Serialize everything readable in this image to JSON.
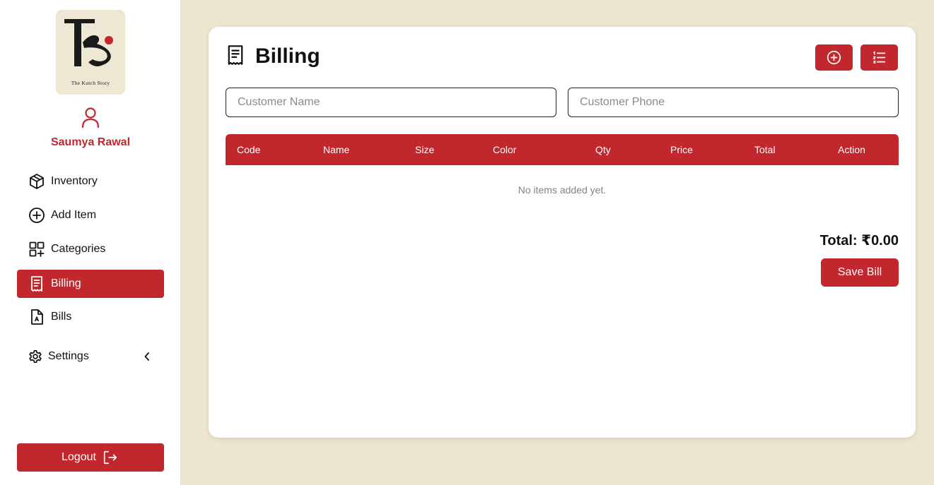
{
  "brand": {
    "logo_text": "The Kutch Story",
    "accent_color": "#c1272d",
    "background_color": "#eee7d0"
  },
  "user": {
    "icon": "user-icon",
    "name": "Saumya Rawal"
  },
  "sidebar": {
    "items": [
      {
        "label": "Inventory",
        "icon": "package-icon",
        "active": false
      },
      {
        "label": "Add Item",
        "icon": "plus-circle-icon",
        "active": false
      },
      {
        "label": "Categories",
        "icon": "grid-plus-icon",
        "active": false
      },
      {
        "label": "Billing",
        "icon": "receipt-icon",
        "active": true
      },
      {
        "label": "Bills",
        "icon": "file-icon",
        "active": false
      },
      {
        "label": "Settings",
        "icon": "gear-icon",
        "active": false,
        "expandable": true
      }
    ],
    "logout_label": "Logout"
  },
  "main": {
    "title": "Billing",
    "title_icon": "receipt-icon",
    "header_buttons": [
      {
        "icon": "plus-circle-icon"
      },
      {
        "icon": "list-icon"
      }
    ],
    "customer_name_placeholder": "Customer Name",
    "customer_phone_placeholder": "Customer Phone",
    "table": {
      "columns": [
        "Code",
        "Name",
        "Size",
        "Color",
        "Qty",
        "Price",
        "Total",
        "Action"
      ],
      "rows": [],
      "empty_message": "No items added yet."
    },
    "total_text": "Total: ₹0.00",
    "save_label": "Save Bill"
  }
}
